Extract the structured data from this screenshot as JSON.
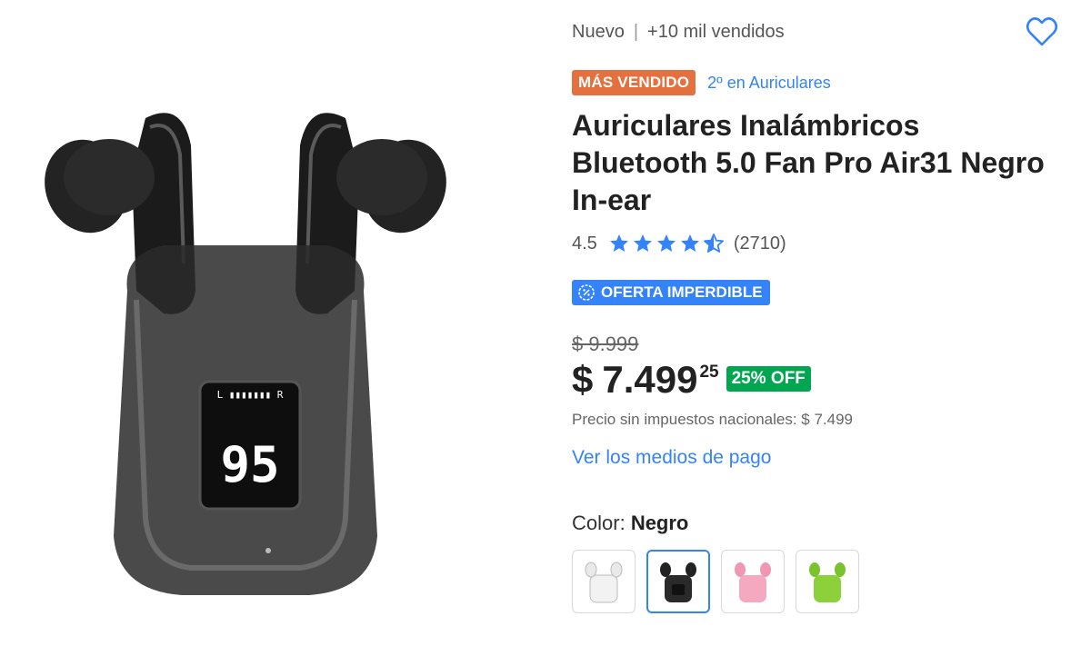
{
  "product": {
    "condition": "Nuevo",
    "separator": "|",
    "sold": "+10 mil vendidos",
    "best_seller_badge": "MÁS VENDIDO",
    "ranking": "2º en Auriculares",
    "title": "Auriculares Inalámbricos Bluetooth 5.0 Fan Pro Air31 Negro In-ear",
    "rating": {
      "value": "4.5",
      "stars": 4.5,
      "count": "(2710)"
    },
    "deal_badge": "OFERTA IMPERDIBLE",
    "image_display": "95"
  },
  "price": {
    "original": "$ 9.999",
    "currency": "$",
    "integer": "7.499",
    "cents": "25",
    "discount": "25% OFF",
    "no_tax": "Precio sin impuestos nacionales: $ 7.499"
  },
  "payment_link": "Ver los medios de pago",
  "color": {
    "label": "Color:",
    "selected": "Negro",
    "options": [
      {
        "name": "white",
        "accent": "#f2f2f2"
      },
      {
        "name": "black",
        "accent": "#222222"
      },
      {
        "name": "pink",
        "accent": "#f4a9c0"
      },
      {
        "name": "green",
        "accent": "#8cd13a"
      }
    ]
  },
  "colors": {
    "brand_blue": "#3483fa",
    "best_seller_orange": "#e4703f",
    "discount_green": "#00a650"
  }
}
